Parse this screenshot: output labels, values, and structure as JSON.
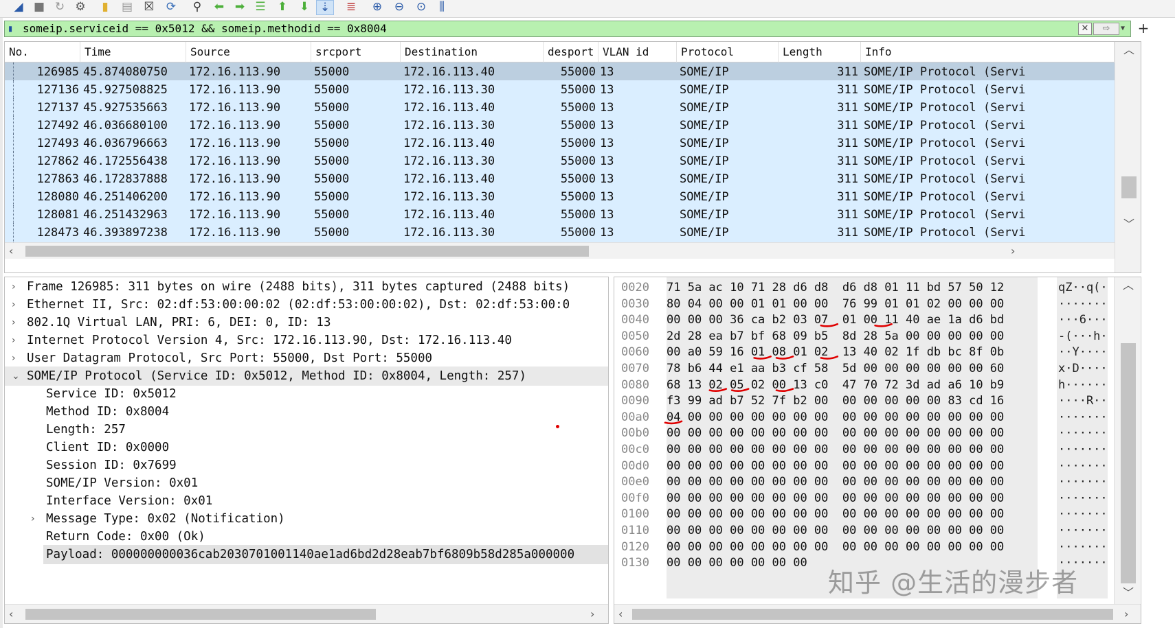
{
  "toolbar": {
    "icons": [
      "shark-fin-start-icon",
      "stop-square-icon",
      "restart-icon",
      "capture-options-gear-icon",
      "open-folder-icon",
      "save-file-icon",
      "close-file-icon",
      "reload-icon",
      "find-packet-icon",
      "go-back-icon",
      "go-forward-icon",
      "go-to-packet-icon",
      "go-first-icon",
      "go-last-icon",
      "autoscroll-icon",
      "colorize-icon",
      "zoom-in-icon",
      "zoom-out-icon",
      "zoom-normal-icon",
      "resize-columns-icon"
    ]
  },
  "filter": {
    "value": "someip.serviceid == 0x5012 && someip.methodid == 0x8004",
    "bg_color": "#b8f0b0"
  },
  "packet_list": {
    "columns": [
      "No.",
      "Time",
      "Source",
      "srcport",
      "Destination",
      "desport",
      "VLAN id",
      "Protocol",
      "Length",
      "Info"
    ],
    "rows": [
      {
        "no": "126985",
        "time": "45.874080750",
        "source": "172.16.113.90",
        "srcport": "55000",
        "destination": "172.16.113.40",
        "desport": "55000",
        "vlan": "13",
        "protocol": "SOME/IP",
        "length": "311",
        "info": "SOME/IP Protocol (Servi"
      },
      {
        "no": "127136",
        "time": "45.927508825",
        "source": "172.16.113.90",
        "srcport": "55000",
        "destination": "172.16.113.30",
        "desport": "55000",
        "vlan": "13",
        "protocol": "SOME/IP",
        "length": "311",
        "info": "SOME/IP Protocol (Servi"
      },
      {
        "no": "127137",
        "time": "45.927535663",
        "source": "172.16.113.90",
        "srcport": "55000",
        "destination": "172.16.113.40",
        "desport": "55000",
        "vlan": "13",
        "protocol": "SOME/IP",
        "length": "311",
        "info": "SOME/IP Protocol (Servi"
      },
      {
        "no": "127492",
        "time": "46.036680100",
        "source": "172.16.113.90",
        "srcport": "55000",
        "destination": "172.16.113.30",
        "desport": "55000",
        "vlan": "13",
        "protocol": "SOME/IP",
        "length": "311",
        "info": "SOME/IP Protocol (Servi"
      },
      {
        "no": "127493",
        "time": "46.036796663",
        "source": "172.16.113.90",
        "srcport": "55000",
        "destination": "172.16.113.40",
        "desport": "55000",
        "vlan": "13",
        "protocol": "SOME/IP",
        "length": "311",
        "info": "SOME/IP Protocol (Servi"
      },
      {
        "no": "127862",
        "time": "46.172556438",
        "source": "172.16.113.90",
        "srcport": "55000",
        "destination": "172.16.113.30",
        "desport": "55000",
        "vlan": "13",
        "protocol": "SOME/IP",
        "length": "311",
        "info": "SOME/IP Protocol (Servi"
      },
      {
        "no": "127863",
        "time": "46.172837888",
        "source": "172.16.113.90",
        "srcport": "55000",
        "destination": "172.16.113.40",
        "desport": "55000",
        "vlan": "13",
        "protocol": "SOME/IP",
        "length": "311",
        "info": "SOME/IP Protocol (Servi"
      },
      {
        "no": "128080",
        "time": "46.251406200",
        "source": "172.16.113.90",
        "srcport": "55000",
        "destination": "172.16.113.30",
        "desport": "55000",
        "vlan": "13",
        "protocol": "SOME/IP",
        "length": "311",
        "info": "SOME/IP Protocol (Servi"
      },
      {
        "no": "128081",
        "time": "46.251432963",
        "source": "172.16.113.90",
        "srcport": "55000",
        "destination": "172.16.113.40",
        "desport": "55000",
        "vlan": "13",
        "protocol": "SOME/IP",
        "length": "311",
        "info": "SOME/IP Protocol (Servi"
      },
      {
        "no": "128473",
        "time": "46.393897238",
        "source": "172.16.113.90",
        "srcport": "55000",
        "destination": "172.16.113.30",
        "desport": "55000",
        "vlan": "13",
        "protocol": "SOME/IP",
        "length": "311",
        "info": "SOME/IP Protocol (Servi"
      }
    ],
    "row_color": "#daeeff",
    "selected_row_color": "#bccfe0"
  },
  "details": {
    "items": [
      {
        "text": "Frame 126985: 311 bytes on wire (2488 bits), 311 bytes captured (2488 bits)",
        "arrow": "›"
      },
      {
        "text": "Ethernet II, Src: 02:df:53:00:00:02 (02:df:53:00:00:02), Dst: 02:df:53:00:0",
        "arrow": "›"
      },
      {
        "text": "802.1Q Virtual LAN, PRI: 6, DEI: 0, ID: 13",
        "arrow": "›"
      },
      {
        "text": "Internet Protocol Version 4, Src: 172.16.113.90, Dst: 172.16.113.40",
        "arrow": "›"
      },
      {
        "text": "User Datagram Protocol, Src Port: 55000, Dst Port: 55000",
        "arrow": "›"
      },
      {
        "text": "SOME/IP Protocol (Service ID: 0x5012, Method ID: 0x8004, Length: 257)",
        "arrow": "⌄"
      },
      {
        "text": "Service ID: 0x5012",
        "arrow": ""
      },
      {
        "text": "Method ID: 0x8004",
        "arrow": ""
      },
      {
        "text": "Length: 257",
        "arrow": ""
      },
      {
        "text": "Client ID: 0x0000",
        "arrow": ""
      },
      {
        "text": "Session ID: 0x7699",
        "arrow": ""
      },
      {
        "text": "SOME/IP Version: 0x01",
        "arrow": ""
      },
      {
        "text": "Interface Version: 0x01",
        "arrow": ""
      },
      {
        "text": "Message Type: 0x02 (Notification)",
        "arrow": "›"
      },
      {
        "text": "Return Code: 0x00 (Ok)",
        "arrow": ""
      },
      {
        "text": "Payload: 000000000036cab2030701001140ae1ad6bd2d28eab7bf6809b58d285a000000",
        "arrow": ""
      }
    ]
  },
  "bytes": {
    "rows": [
      {
        "offset": "0020",
        "hex": "71 5a ac 10 71 28 d6 d8  d6 d8 01 11 bd 57 50 12",
        "ascii": "qZ··q(··  ·"
      },
      {
        "offset": "0030",
        "hex": "80 04 00 00 01 01 00 00  76 99 01 01 02 00 00 00",
        "ascii": "········  v"
      },
      {
        "offset": "0040",
        "hex": "00 00 00 36 ca b2 03 07  01 00 11 40 ae 1a d6 bd",
        "ascii": "···6····  ·"
      },
      {
        "offset": "0050",
        "hex": "2d 28 ea b7 bf 68 09 b5  8d 28 5a 00 00 00 00 00",
        "ascii": "-(···h··  ·"
      },
      {
        "offset": "0060",
        "hex": "00 a0 59 16 01 08 01 02  13 40 02 1f db bc 8f 0b",
        "ascii": "··Y·····  ·"
      },
      {
        "offset": "0070",
        "hex": "78 b6 44 e1 aa b3 cf 58  5d 00 00 00 00 00 00 60",
        "ascii": "x·D····X  ]"
      },
      {
        "offset": "0080",
        "hex": "68 13 02 05 02 00 13 c0  47 70 72 3d ad a6 10 b9",
        "ascii": "h·······  G"
      },
      {
        "offset": "0090",
        "hex": "f3 99 ad b7 52 7f b2 00  00 00 00 00 00 83 cd 16",
        "ascii": "····R···  ·"
      },
      {
        "offset": "00a0",
        "hex": "04 00 00 00 00 00 00 00  00 00 00 00 00 00 00 00",
        "ascii": "········  ·"
      },
      {
        "offset": "00b0",
        "hex": "00 00 00 00 00 00 00 00  00 00 00 00 00 00 00 00",
        "ascii": "········  ·"
      },
      {
        "offset": "00c0",
        "hex": "00 00 00 00 00 00 00 00  00 00 00 00 00 00 00 00",
        "ascii": "········  ·"
      },
      {
        "offset": "00d0",
        "hex": "00 00 00 00 00 00 00 00  00 00 00 00 00 00 00 00",
        "ascii": "········  ·"
      },
      {
        "offset": "00e0",
        "hex": "00 00 00 00 00 00 00 00  00 00 00 00 00 00 00 00",
        "ascii": "········  ·"
      },
      {
        "offset": "00f0",
        "hex": "00 00 00 00 00 00 00 00  00 00 00 00 00 00 00 00",
        "ascii": "········  ·"
      },
      {
        "offset": "0100",
        "hex": "00 00 00 00 00 00 00 00  00 00 00 00 00 00 00 00",
        "ascii": "········  ·"
      },
      {
        "offset": "0110",
        "hex": "00 00 00 00 00 00 00 00  00 00 00 00 00 00 00 00",
        "ascii": "········  ·"
      },
      {
        "offset": "0120",
        "hex": "00 00 00 00 00 00 00 00  00 00 00 00 00 00 00 00",
        "ascii": "········  ·"
      },
      {
        "offset": "0130",
        "hex": "00 00 00 00 00 00 00",
        "ascii": "·······"
      }
    ],
    "annotation_color": "#e00000"
  },
  "watermark": "知乎 @生活的漫步者"
}
